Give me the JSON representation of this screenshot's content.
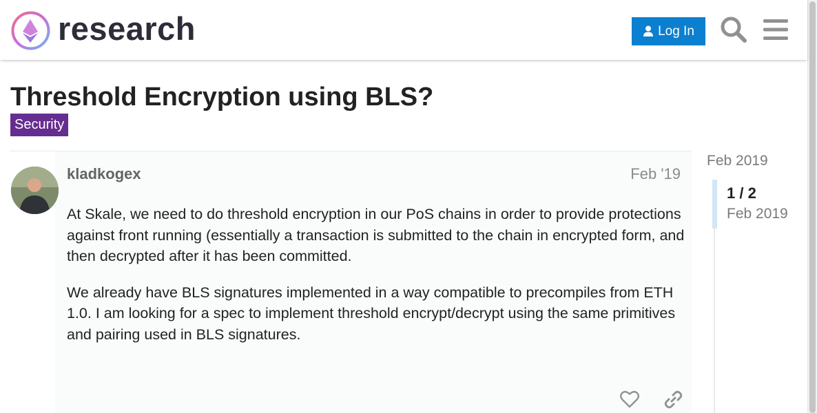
{
  "header": {
    "site_name": "research",
    "login_label": "Log In"
  },
  "topic": {
    "title": "Threshold Encryption using BLS?",
    "category": "Security",
    "category_color": "#652d90"
  },
  "post": {
    "username": "kladkogex",
    "date": "Feb '19",
    "paragraphs": [
      "At Skale, we need to do threshold encryption in our PoS chains in order to provide protections against front running (essentially a transaction is submitted to the chain in encrypted form, and then decrypted after it has been committed.",
      "We already have BLS signatures implemented in a way compatible to precompiles from ETH 1.0. I am looking for a spec to implement threshold encrypt/decrypt using the same primitives and pairing used in BLS signatures."
    ]
  },
  "timeline": {
    "start_date": "Feb 2019",
    "position": "1 / 2",
    "current_date": "Feb 2019"
  },
  "colors": {
    "accent": "#0b7fd0"
  },
  "icons": [
    "ethereum-logo-icon",
    "user-icon",
    "search-icon",
    "hamburger-menu-icon",
    "heart-icon",
    "link-icon"
  ]
}
